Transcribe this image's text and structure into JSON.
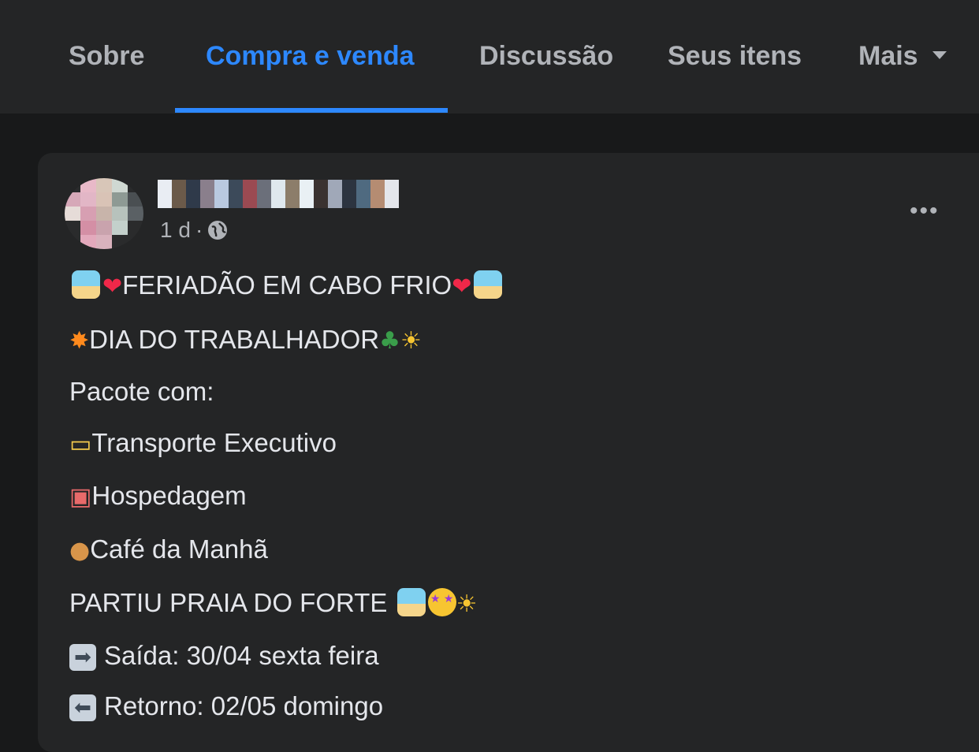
{
  "nav": {
    "tabs": [
      {
        "label": "Sobre",
        "active": false
      },
      {
        "label": "Compra e venda",
        "active": true
      },
      {
        "label": "Discussão",
        "active": false
      },
      {
        "label": "Seus itens",
        "active": false
      },
      {
        "label": "Mais",
        "active": false
      }
    ],
    "accent_color": "#2d88ff"
  },
  "post": {
    "time": "1 d",
    "separator": "·",
    "privacy_icon": "globe-icon",
    "menu_icon": "more-options-icon",
    "more_label": "•••",
    "lines": [
      "FERIADÃO EM CABO FRIO",
      "DIA DO TRABALHADOR",
      "Pacote com:",
      "Transporte Executivo",
      "Hospedagem",
      "Café da Manhã",
      "PARTIU PRAIA DO FORTE",
      "Saída: 30/04 sexta feira",
      "Retorno: 02/05 domingo"
    ]
  }
}
